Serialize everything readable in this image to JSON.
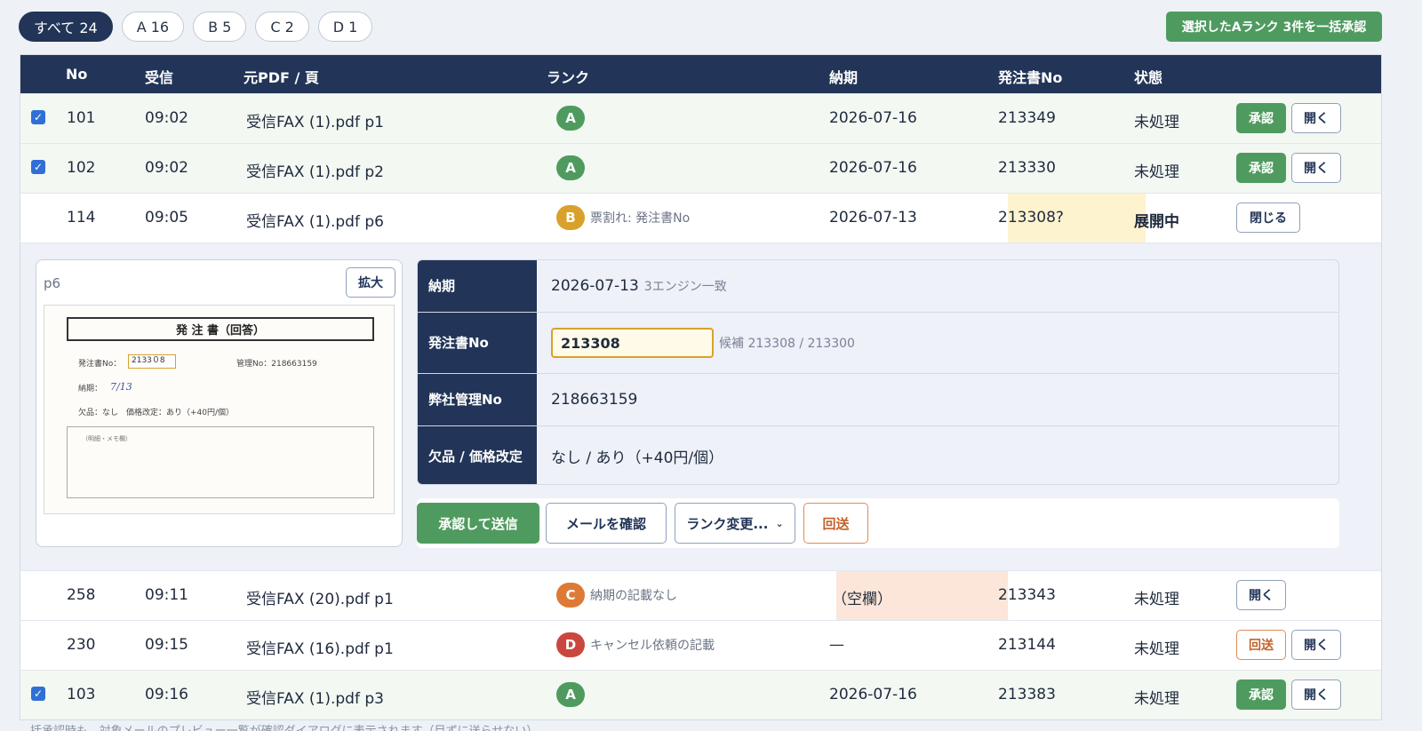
{
  "filters": [
    {
      "label": "すべて 24",
      "active": true
    },
    {
      "label": "A 16"
    },
    {
      "label": "B 5"
    },
    {
      "label": "C 2"
    },
    {
      "label": "D 1"
    }
  ],
  "bulk_approve_label": "選択したAランク 3件を一括承認",
  "headers": {
    "no": "No",
    "received": "受信",
    "pdf": "元PDF / 頁",
    "rank": "ランク",
    "due": "納期",
    "po": "発注書No",
    "status": "状態"
  },
  "rows": [
    {
      "no": "101",
      "time": "09:02",
      "pdf": "受信FAX (1).pdf p1",
      "rank": "A",
      "note": "",
      "due": "2026-07-16",
      "po": "213349",
      "status": "未処理",
      "btn_approve": "承認",
      "btn_open": "開く"
    },
    {
      "no": "102",
      "time": "09:02",
      "pdf": "受信FAX (1).pdf p2",
      "rank": "A",
      "note": "",
      "due": "2026-07-16",
      "po": "213330",
      "status": "未処理",
      "btn_approve": "承認",
      "btn_open": "開く"
    },
    {
      "no": "114",
      "time": "09:05",
      "pdf": "受信FAX (1).pdf p6",
      "rank": "B",
      "note": "票割れ: 発注書No",
      "due": "2026-07-13",
      "po": "213308?",
      "status": "展開中",
      "btn_close": "閉じる"
    },
    {
      "no": "258",
      "time": "09:11",
      "pdf": "受信FAX (20).pdf p1",
      "rank": "C",
      "note": "納期の記載なし",
      "due": "（空欄）",
      "po": "213343",
      "status": "未処理",
      "btn_open": "開く"
    },
    {
      "no": "230",
      "time": "09:15",
      "pdf": "受信FAX (16).pdf p1",
      "rank": "D",
      "note": "キャンセル依頼の記載",
      "due": "—",
      "po": "213144",
      "status": "未処理",
      "btn_return": "回送",
      "btn_open": "開く"
    },
    {
      "no": "103",
      "time": "09:16",
      "pdf": "受信FAX (1).pdf p3",
      "rank": "A",
      "note": "",
      "due": "2026-07-16",
      "po": "213383",
      "status": "未処理",
      "btn_approve": "承認",
      "btn_open": "開く"
    }
  ],
  "rank_colors": {
    "A": "#4f9b5f",
    "B": "#d9a12c",
    "C": "#dd7a35",
    "D": "#c9473f"
  },
  "detail": {
    "page_label": "p6",
    "zoom_label": "拡大",
    "doc": {
      "title": "発 注 書（回答）",
      "po_label": "発注書No：",
      "po_written": "2133０8",
      "mgmt": "管理No：218663159",
      "due_label": "納期：",
      "due_written": "7/13",
      "shortage": "欠品：なし　価格改定：あり（+40円/個）",
      "memo": "（明細・メモ欄）"
    },
    "fields": {
      "due_label": "納期",
      "due_value": "2026-07-13",
      "due_sub": "3エンジン一致",
      "po_label": "発注書No",
      "po_value": "213308",
      "po_candidates": "候補 213308 / 213300",
      "mgmt_label": "弊社管理No",
      "mgmt_value": "218663159",
      "shortage_label": "欠品 / 価格改定",
      "shortage_value": "なし / あり（+40円/個）"
    },
    "actions": {
      "send": "承認して送信",
      "mail": "メールを確認",
      "rank_change": "ランク変更...",
      "return": "回送"
    }
  },
  "footer_note": "括承認時も、対象メールのプレビュー一覧が確認ダイアログに表示されます（目ずに送らせない）"
}
